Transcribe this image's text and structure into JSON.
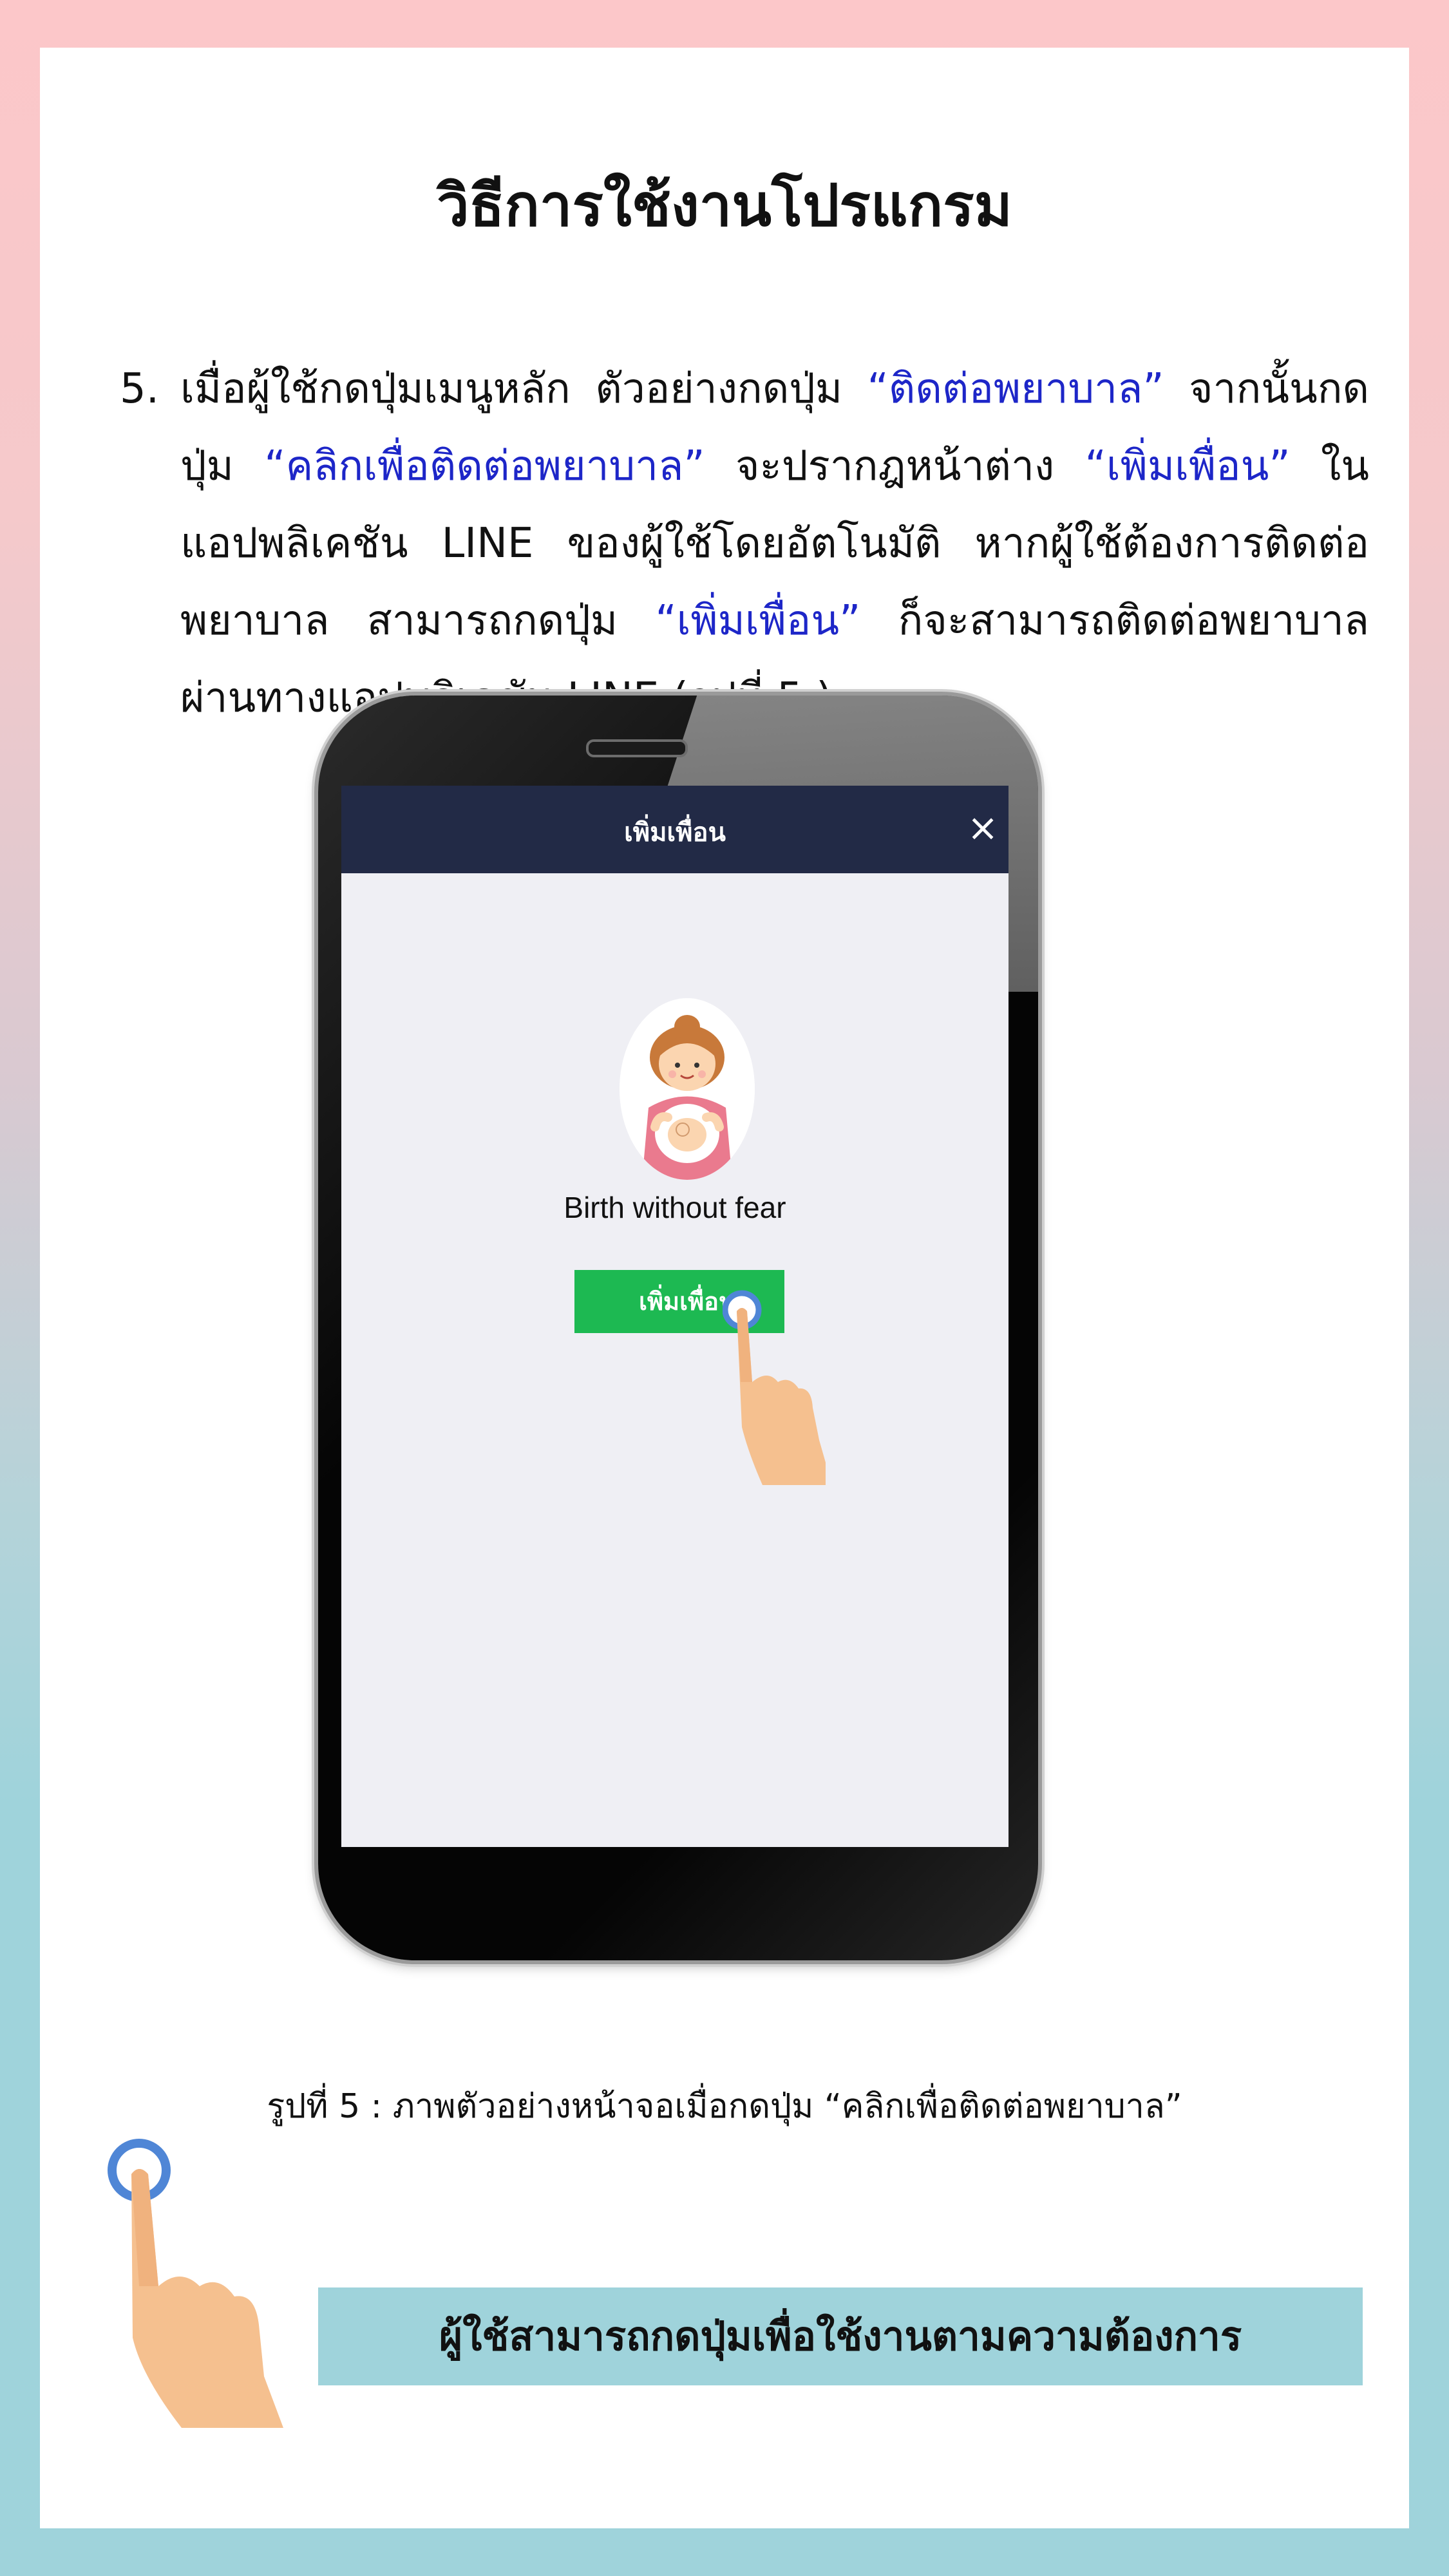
{
  "page": {
    "title": "วิธีการใช้งานโปรแกรม",
    "step": {
      "number": "5.",
      "text_1": "เมื่อผู้ใช้กดปุ่มเมนูหลัก ตัวอย่างกดปุ่ม ",
      "highlight_1": "“ติดต่อพยาบาล”",
      "text_2": " จากนั้นกดปุ่ม ",
      "highlight_2": "“คลิกเพื่อติดต่อพยาบาล”",
      "text_3": " จะปรากฎหน้าต่าง ",
      "highlight_3": "“เพิ่มเพื่อน”",
      "text_4": " ในแอปพลิเคชัน LINE ของผู้ใช้โดยอัตโนมัติ หากผู้ใช้ต้องการติดต่อพยาบาล สามารถกดปุ่ม ",
      "highlight_4": "“เพิ่มเพื่อน”",
      "text_5": " ก็จะสามารถติดต่อพยาบาลผ่านทางแอปพลิเคชัน LINE (รูปที่ 5 )"
    },
    "phone_screen": {
      "header_title": "เพิ่มเพื่อน",
      "close_symbol": "×",
      "profile_name": "Birth without fear",
      "add_friend_button": "เพิ่มเพื่อน"
    },
    "caption": "รูปที่ 5 : ภาพตัวอย่างหน้าจอเมื่อกดปุ่ม “คลิกเพื่อติดต่อพยาบาล”",
    "banner": "ผู้ใช้สามารถกดปุ่มเพื่อใช้งานตามความต้องการ"
  },
  "colors": {
    "highlight": "#1d26c8",
    "line_header": "#222a46",
    "line_green": "#1db952",
    "banner_bg": "#9fd3db",
    "tap_ring": "#4f86d6",
    "skin": "#f5c08f"
  },
  "icons": [
    "close-icon",
    "tap-hand-icon",
    "pregnant-mother-avatar"
  ]
}
